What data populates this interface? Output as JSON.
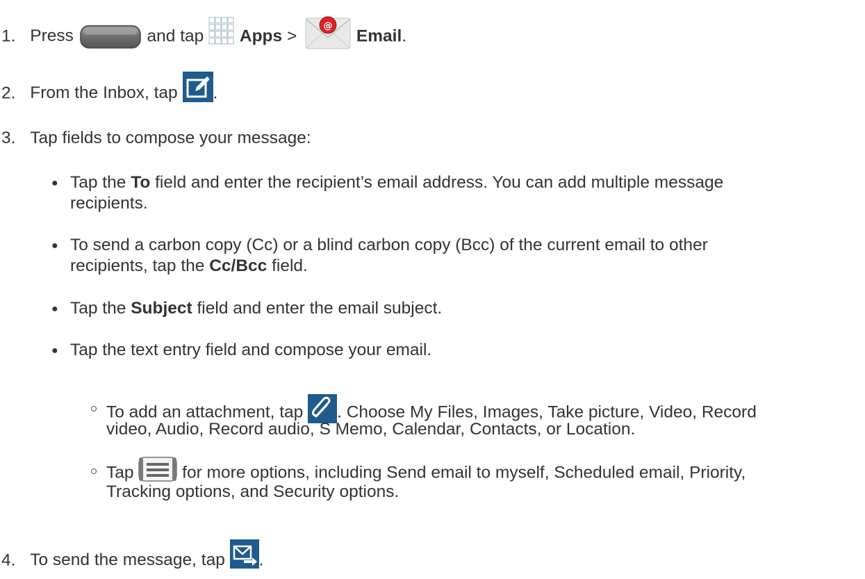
{
  "steps": [
    {
      "num": "1.",
      "pre": "Press",
      "mid": "and tap",
      "apps": "Apps",
      "gt": ">",
      "email": "Email",
      "end": "."
    },
    {
      "num": "2.",
      "text": "From the Inbox, tap",
      "end": "."
    },
    {
      "num": "3.",
      "text": "Tap fields to compose your message:"
    },
    {
      "num": "4.",
      "text": "To send the message, tap",
      "end": "."
    }
  ],
  "bullets": {
    "to": {
      "pre": "Tap the",
      "bold": "To",
      "post": "field and enter the recipient’s email address. You can add multiple message",
      "line2": "recipients."
    },
    "cc": {
      "line1": "To send a carbon copy (Cc) or a blind carbon copy (Bcc) of the current email to other",
      "pre2": "recipients, tap the",
      "bold": "Cc/Bcc",
      "post2": "field."
    },
    "subject": {
      "pre": "Tap the",
      "bold": "Subject",
      "post": "field and enter the email subject."
    },
    "body": {
      "text": "Tap the text entry field and compose your email."
    }
  },
  "subbullets": {
    "attach": {
      "pre": "To add an attachment, tap",
      "post": ". Choose My Files, Images, Take picture, Video, Record",
      "line2": "video, Audio, Record audio, S Memo, Calendar, Contacts, or Location."
    },
    "menu": {
      "pre": "Tap",
      "post": "for more options, including Send email to myself, Scheduled email, Priority,",
      "line2": "Tracking options, and Security options."
    }
  },
  "icons": {
    "home_key": "home-key-icon",
    "apps": "apps-grid-icon",
    "email": "email-envelope-icon",
    "compose": "compose-icon",
    "attach": "paperclip-icon",
    "menu": "menu-key-icon",
    "send": "send-icon"
  },
  "colors": {
    "text": "#333333",
    "icon_blue": "#1f5b8c",
    "email_red": "#d8232a"
  }
}
